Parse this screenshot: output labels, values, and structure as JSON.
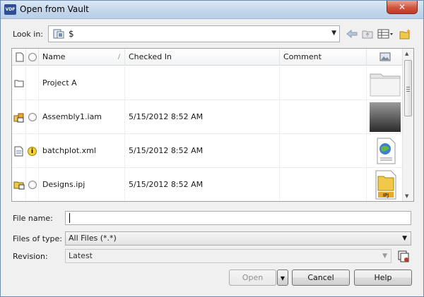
{
  "window": {
    "title": "Open from Vault",
    "app_icon_label": "VDF",
    "close_glyph": "✕"
  },
  "lookin": {
    "label": "Look in:",
    "value": "$"
  },
  "columns": {
    "name": "Name",
    "checked_in": "Checked In",
    "comment": "Comment"
  },
  "rows": [
    {
      "name": "Project A",
      "checked_in": "",
      "comment": ""
    },
    {
      "name": "Assembly1.iam",
      "checked_in": "5/15/2012 8:52 AM",
      "comment": ""
    },
    {
      "name": "batchplot.xml",
      "checked_in": "5/15/2012 8:52 AM",
      "comment": ""
    },
    {
      "name": "Designs.ipj",
      "checked_in": "5/15/2012 8:52 AM",
      "comment": ""
    }
  ],
  "thumb_label_ipj": "IPJ",
  "form": {
    "file_name_label": "File name:",
    "file_name_value": "",
    "files_of_type_label": "Files of type:",
    "files_of_type_value": "All Files (*.*)",
    "revision_label": "Revision:",
    "revision_value": "Latest"
  },
  "buttons": {
    "open": "Open",
    "cancel": "Cancel",
    "help": "Help"
  },
  "colors": {
    "title_bar": "#c3d6ea",
    "close": "#d2533b",
    "folder": "#f1c94a"
  }
}
